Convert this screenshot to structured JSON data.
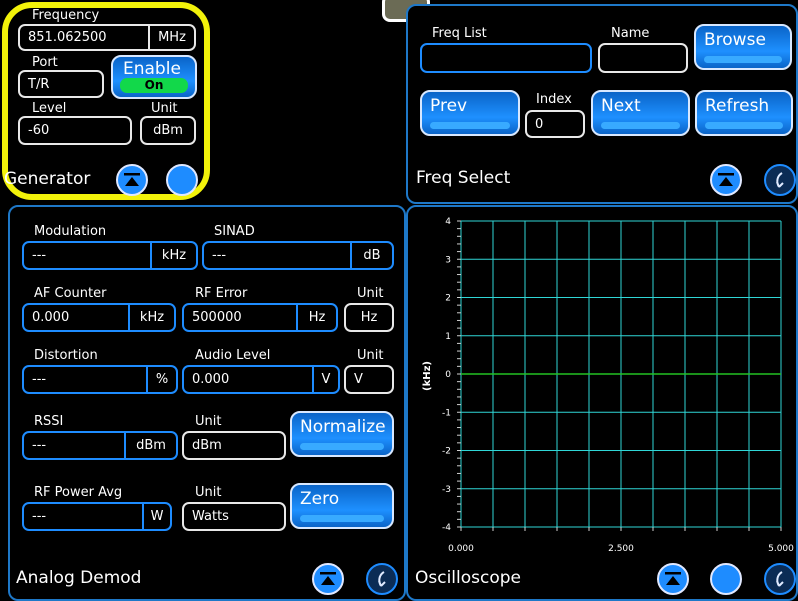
{
  "generator": {
    "title": "Generator",
    "frequency_label": "Frequency",
    "frequency_value": "851.062500",
    "frequency_unit": "MHz",
    "port_label": "Port",
    "port_value": "T/R",
    "enable_label": "Enable",
    "enable_state": "On",
    "level_label": "Level",
    "level_value": "-60",
    "unit_label": "Unit",
    "unit_value": "dBm"
  },
  "freq_select": {
    "title": "Freq Select",
    "freq_list_label": "Freq List",
    "freq_list_value": "",
    "name_label": "Name",
    "name_value": "",
    "browse_label": "Browse",
    "prev_label": "Prev",
    "index_label": "Index",
    "index_value": "0",
    "next_label": "Next",
    "refresh_label": "Refresh"
  },
  "analog_demod": {
    "title": "Analog Demod",
    "modulation_label": "Modulation",
    "modulation_value": "---",
    "modulation_unit": "kHz",
    "sinad_label": "SINAD",
    "sinad_value": "---",
    "sinad_unit": "dB",
    "af_counter_label": "AF Counter",
    "af_counter_value": "0.000",
    "af_counter_unit": "kHz",
    "rf_error_label": "RF Error",
    "rf_error_value": "500000",
    "rf_error_unit": "Hz",
    "rf_error_unit_label": "Unit",
    "rf_error_unit_select": "Hz",
    "distortion_label": "Distortion",
    "distortion_value": "---",
    "distortion_unit": "%",
    "audio_level_label": "Audio Level",
    "audio_level_value": "0.000",
    "audio_level_unit": "V",
    "audio_unit_label": "Unit",
    "audio_unit_select": "V",
    "rssi_label": "RSSI",
    "rssi_value": "---",
    "rssi_unit": "dBm",
    "rssi_unit_label": "Unit",
    "rssi_unit_select": "dBm",
    "normalize_label": "Normalize",
    "rf_power_label": "RF Power Avg",
    "rf_power_value": "---",
    "rf_power_unit": "W",
    "rf_power_unit_label": "Unit",
    "rf_power_unit_select": "Watts",
    "zero_label": "Zero"
  },
  "oscilloscope": {
    "title": "Oscilloscope",
    "y_label": "(kHz)",
    "y_ticks": [
      "4",
      "3",
      "2",
      "1",
      "0",
      "-1",
      "-2",
      "-3",
      "-4"
    ],
    "x_ticks": [
      "0.000",
      "2.500",
      "5.000"
    ],
    "grid_color": "#2fd6d6",
    "trace_color": "#22c322",
    "trace_level": 0
  },
  "colors": {
    "highlight": "#f2f20a",
    "accent": "#1e8cff",
    "panel_border": "#1e78c8",
    "toggle_on": "#12d84a"
  }
}
